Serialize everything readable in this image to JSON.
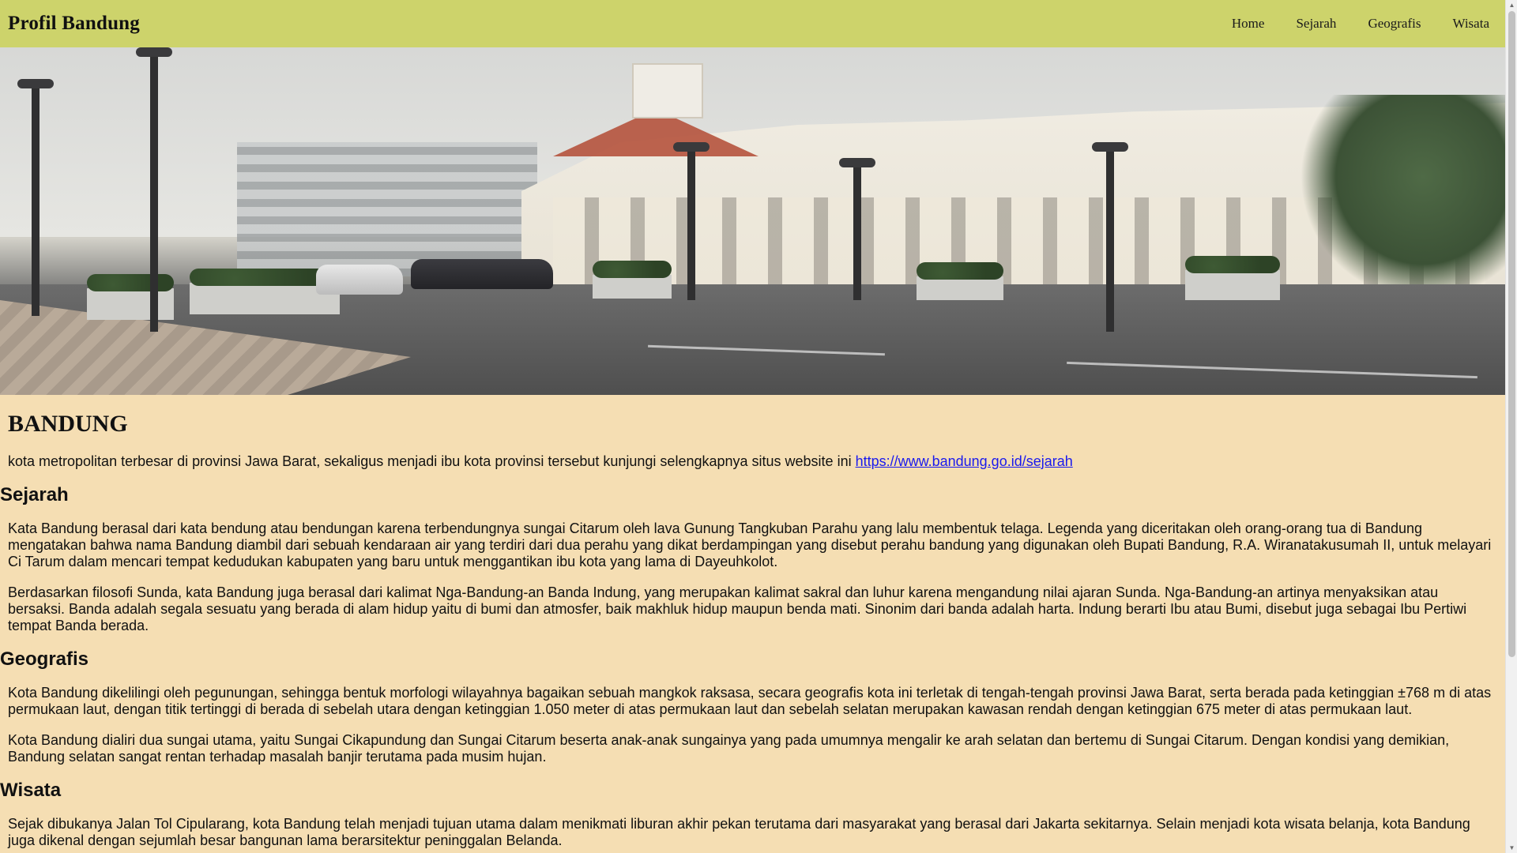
{
  "header": {
    "brand": "Profil Bandung",
    "nav": [
      "Home",
      "Sejarah",
      "Geografis",
      "Wisata"
    ]
  },
  "hero": {
    "alt": "Bandung street with colonial buildings"
  },
  "page": {
    "title": "BANDUNG",
    "intro_text": "kota metropolitan terbesar di provinsi Jawa Barat, sekaligus menjadi ibu kota provinsi tersebut kunjungi selengkapnya situs website ini ",
    "intro_link": "https://www.bandung.go.id/sejarah"
  },
  "sections": {
    "sejarah": {
      "title": "Sejarah",
      "p1": "Kata Bandung berasal dari kata bendung atau bendungan karena terbendungnya sungai Citarum oleh lava Gunung Tangkuban Parahu yang lalu membentuk telaga. Legenda yang diceritakan oleh orang-orang tua di Bandung mengatakan bahwa nama Bandung diambil dari sebuah kendaraan air yang terdiri dari dua perahu yang dikat berdampingan yang disebut perahu bandung yang digunakan oleh Bupati Bandung, R.A. Wiranatakusumah II, untuk melayari Ci Tarum dalam mencari tempat kedudukan kabupaten yang baru untuk menggantikan ibu kota yang lama di Dayeuhkolot.",
      "p2": "Berdasarkan filosofi Sunda, kata Bandung juga berasal dari kalimat Nga-Bandung-an Banda Indung, yang merupakan kalimat sakral dan luhur karena mengandung nilai ajaran Sunda. Nga-Bandung-an artinya menyaksikan atau bersaksi. Banda adalah segala sesuatu yang berada di alam hidup yaitu di bumi dan atmosfer, baik makhluk hidup maupun benda mati. Sinonim dari banda adalah harta. Indung berarti Ibu atau Bumi, disebut juga sebagai Ibu Pertiwi tempat Banda berada."
    },
    "geografis": {
      "title": "Geografis",
      "p1": "Kota Bandung dikelilingi oleh pegunungan, sehingga bentuk morfologi wilayahnya bagaikan sebuah mangkok raksasa, secara geografis kota ini terletak di tengah-tengah provinsi Jawa Barat, serta berada pada ketinggian ±768 m di atas permukaan laut, dengan titik tertinggi di berada di sebelah utara dengan ketinggian 1.050 meter di atas permukaan laut dan sebelah selatan merupakan kawasan rendah dengan ketinggian 675 meter di atas permukaan laut.",
      "p2": "Kota Bandung dialiri dua sungai utama, yaitu Sungai Cikapundung dan Sungai Citarum beserta anak-anak sungainya yang pada umumnya mengalir ke arah selatan dan bertemu di Sungai Citarum. Dengan kondisi yang demikian, Bandung selatan sangat rentan terhadap masalah banjir terutama pada musim hujan."
    },
    "wisata": {
      "title": "Wisata",
      "p1": "Sejak dibukanya Jalan Tol Cipularang, kota Bandung telah menjadi tujuan utama dalam menikmati liburan akhir pekan terutama dari masyarakat yang berasal dari Jakarta sekitarnya. Selain menjadi kota wisata belanja, kota Bandung juga dikenal dengan sejumlah besar bangunan lama berarsitektur peninggalan Belanda."
    }
  },
  "colors": {
    "header_bg": "#CDD36B",
    "page_bg": "#F5DEB3",
    "link": "#1a1aee"
  },
  "scrollbar": {
    "up_icon": "up-arrow-icon",
    "down_icon": "down-arrow-icon"
  }
}
